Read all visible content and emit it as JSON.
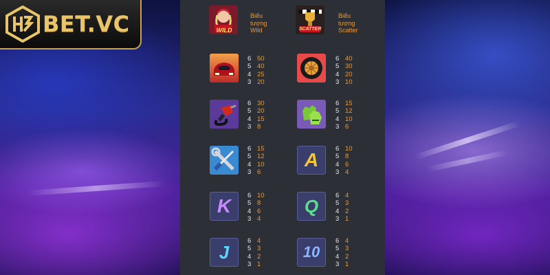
{
  "logo": {
    "text": "BET.VC",
    "mark_icon": "h3-monogram-icon"
  },
  "special": [
    {
      "icon": "wild-driver-icon",
      "badge": "WILD",
      "label": [
        "Biểu",
        "tượng",
        "Wild"
      ]
    },
    {
      "icon": "scatter-trophy-icon",
      "badge": "SCATTER",
      "label": [
        "Biểu",
        "tượng",
        "Scatter"
      ]
    }
  ],
  "left_column": [
    {
      "icon": "red-race-car-icon",
      "counts": [
        "6",
        "5",
        "4",
        "3"
      ],
      "values": [
        "50",
        "40",
        "25",
        "20"
      ]
    },
    {
      "icon": "fuel-nozzle-icon",
      "counts": [
        "6",
        "5",
        "4",
        "3"
      ],
      "values": [
        "30",
        "20",
        "15",
        "8"
      ]
    },
    {
      "icon": "wrench-screwdriver-icon",
      "counts": [
        "6",
        "5",
        "4",
        "3"
      ],
      "values": [
        "15",
        "12",
        "10",
        "6"
      ]
    },
    {
      "icon": "letter-k-icon",
      "letter": "K",
      "counts": [
        "6",
        "5",
        "4",
        "3"
      ],
      "values": [
        "10",
        "8",
        "6",
        "4"
      ]
    },
    {
      "icon": "letter-j-icon",
      "letter": "J",
      "counts": [
        "6",
        "5",
        "4",
        "3"
      ],
      "values": [
        "4",
        "3",
        "2",
        "1"
      ]
    }
  ],
  "right_column": [
    {
      "icon": "racing-tire-icon",
      "counts": [
        "6",
        "5",
        "4",
        "3"
      ],
      "values": [
        "40",
        "30",
        "20",
        "10"
      ]
    },
    {
      "icon": "racing-gloves-icon",
      "counts": [
        "6",
        "5",
        "4",
        "3"
      ],
      "values": [
        "15",
        "12",
        "10",
        "6"
      ]
    },
    {
      "icon": "letter-a-icon",
      "letter": "A",
      "counts": [
        "6",
        "5",
        "4",
        "3"
      ],
      "values": [
        "10",
        "8",
        "6",
        "4"
      ]
    },
    {
      "icon": "letter-q-icon",
      "letter": "Q",
      "counts": [
        "6",
        "5",
        "4",
        "3"
      ],
      "values": [
        "4",
        "3",
        "2",
        "1"
      ]
    },
    {
      "icon": "number-10-icon",
      "letter": "10",
      "counts": [
        "6",
        "5",
        "4",
        "3"
      ],
      "values": [
        "4",
        "3",
        "2",
        "1"
      ]
    }
  ],
  "colors": {
    "panel": "#2d2f36",
    "value": "#f09a2a",
    "count": "#e8e8e8",
    "logo_gold": "#e8c46a"
  }
}
